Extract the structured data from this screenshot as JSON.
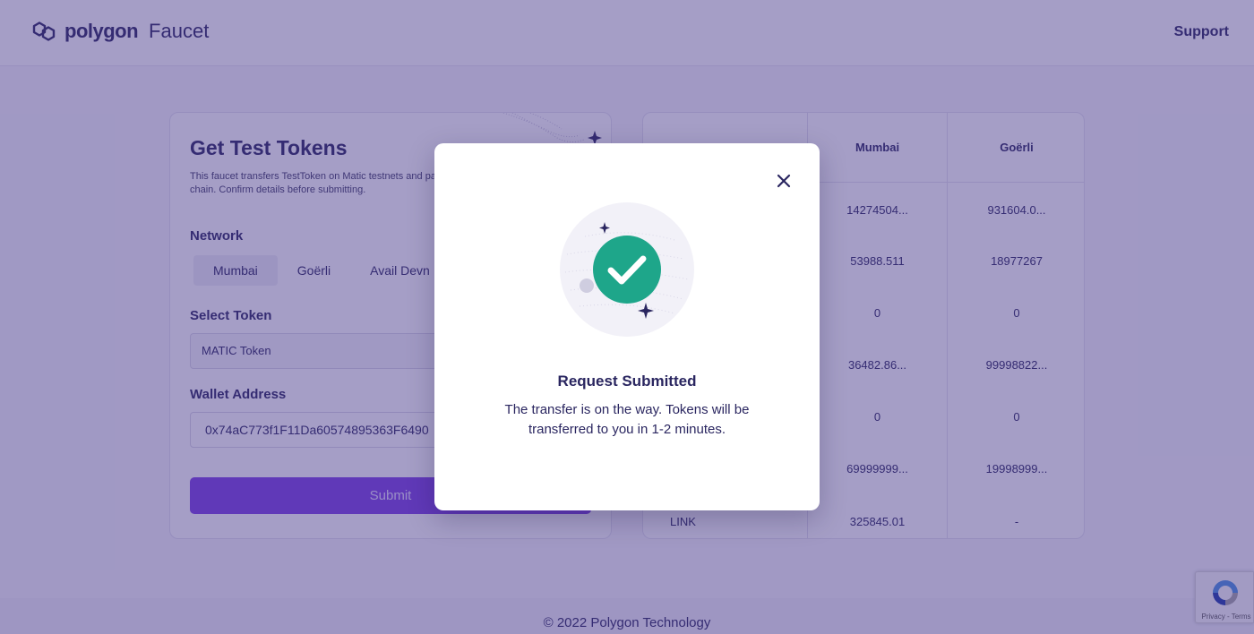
{
  "header": {
    "brand": "polygon",
    "product": "Faucet",
    "support_label": "Support"
  },
  "form": {
    "title": "Get Test Tokens",
    "description": "This faucet transfers TestToken on Matic testnets and parent chain. Confirm details before submitting.",
    "network_label": "Network",
    "networks": [
      "Mumbai",
      "Goërli",
      "Avail Devn"
    ],
    "selected_network": "Mumbai",
    "token_label": "Select Token",
    "token_value": "MATIC Token",
    "wallet_label": "Wallet Address",
    "wallet_value": "0x74aC773f1F11Da60574895363F6490",
    "submit_label": "Submit"
  },
  "balances": {
    "columns": [
      "Mumbai",
      "Goërli"
    ],
    "rows": [
      {
        "token": "",
        "mumbai": "14274504...",
        "goerli": "931604.0..."
      },
      {
        "token": "",
        "mumbai": "53988.511",
        "goerli": "18977267"
      },
      {
        "token": "",
        "mumbai": "0",
        "goerli": "0"
      },
      {
        "token": "",
        "mumbai": "36482.86...",
        "goerli": "99998822..."
      },
      {
        "token": "",
        "mumbai": "0",
        "goerli": "0"
      },
      {
        "token": "",
        "mumbai": "69999999...",
        "goerli": "19998999..."
      },
      {
        "token": "LINK",
        "mumbai": "325845.01",
        "goerli": "-"
      }
    ]
  },
  "footer": {
    "copyright": "© 2022 Polygon Technology"
  },
  "recaptcha": {
    "links": "Privacy - Terms"
  },
  "modal": {
    "title": "Request Submitted",
    "message": "The transfer is on the way. Tokens will be transferred to you in 1-2 minutes.",
    "success_color": "#1ea68a"
  },
  "colors": {
    "brand": "#7b3fe4",
    "text": "#2a2660",
    "overlay": "#423487"
  }
}
